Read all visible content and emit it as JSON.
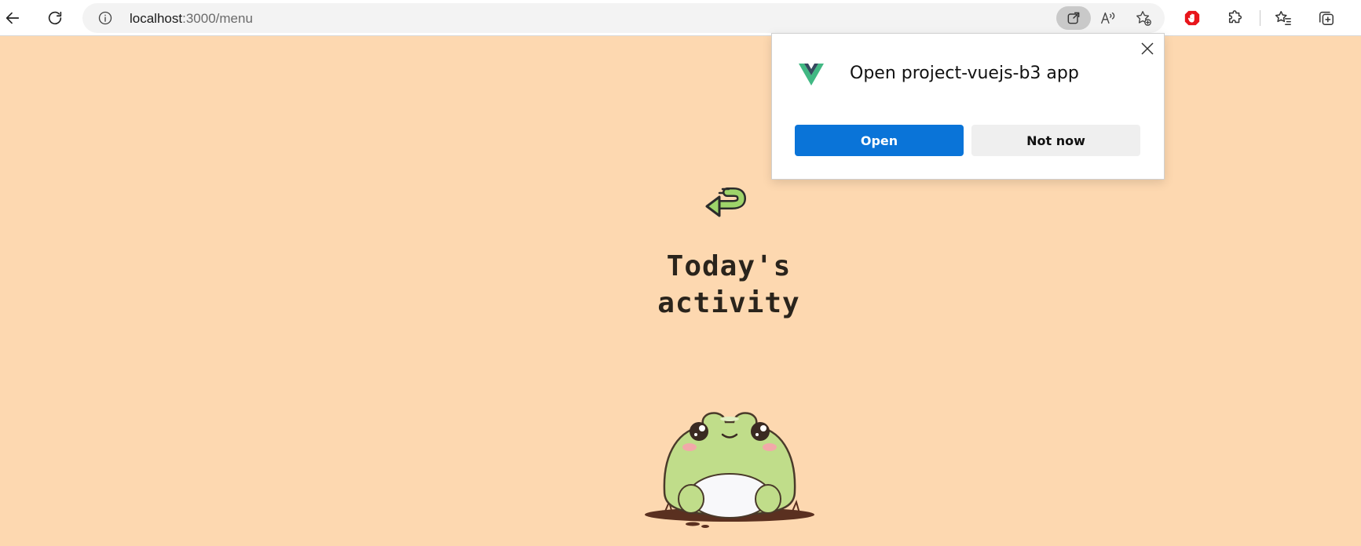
{
  "browser": {
    "url_host": "localhost",
    "url_rest": ":3000/menu",
    "icons": [
      "back-icon",
      "refresh-icon",
      "info-icon",
      "open-in-app-icon",
      "read-aloud-icon",
      "add-favorite-icon",
      "adblock-icon",
      "extensions-icon",
      "favorites-icon",
      "collections-icon"
    ]
  },
  "popup": {
    "title": "Open project-vuejs-b3 app",
    "open_label": "Open",
    "not_now_label": "Not now",
    "colors": {
      "primary": "#0a74d8",
      "secondary": "#efefef"
    }
  },
  "page": {
    "title_line1": "Today's",
    "title_line2": "activity",
    "background": "#fdd8b0"
  }
}
